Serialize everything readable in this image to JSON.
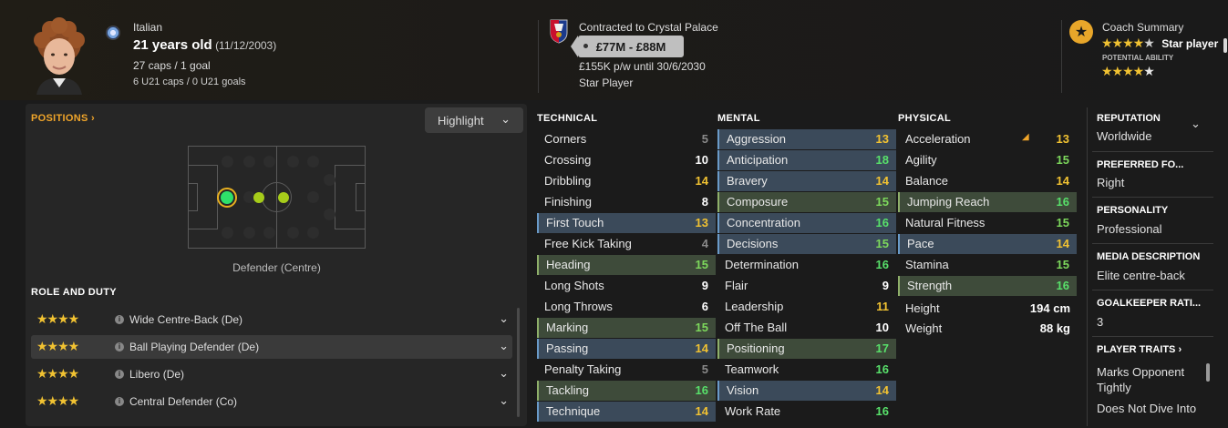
{
  "player": {
    "nationality": "Italian",
    "age_text": "21 years old",
    "dob": "(11/12/2003)",
    "caps": "27 caps / 1 goal",
    "u21": "6 U21 caps / 0 U21 goals"
  },
  "contract": {
    "club_text": "Contracted to Crystal Palace",
    "value": "£77M - £88M",
    "wage": "£155K p/w until 30/6/2030",
    "status": "Star Player"
  },
  "coach": {
    "title": "Coach Summary",
    "current_label": "Star player",
    "current_stars": "★★★★",
    "current_half": "★",
    "potential_title": "POTENTIAL ABILITY",
    "potential_stars": "★★★★",
    "potential_empty": "★"
  },
  "positions": {
    "title": "POSITIONS",
    "chevron": "›",
    "highlight_label": "Highlight",
    "caption": "Defender (Centre)"
  },
  "roles": {
    "title": "ROLE AND DUTY",
    "items": [
      {
        "stars": "★★★★",
        "label": "Wide Centre-Back (De)"
      },
      {
        "stars": "★★★★",
        "label": "Ball Playing Defender (De)"
      },
      {
        "stars": "★★★★",
        "label": "Libero (De)"
      },
      {
        "stars": "★★★★",
        "label": "Central Defender (Co)"
      }
    ]
  },
  "technical": {
    "title": "TECHNICAL",
    "rows": [
      {
        "label": "Corners",
        "value": "5"
      },
      {
        "label": "Crossing",
        "value": "10"
      },
      {
        "label": "Dribbling",
        "value": "14"
      },
      {
        "label": "Finishing",
        "value": "8"
      },
      {
        "label": "First Touch",
        "value": "13"
      },
      {
        "label": "Free Kick Taking",
        "value": "4"
      },
      {
        "label": "Heading",
        "value": "15"
      },
      {
        "label": "Long Shots",
        "value": "9"
      },
      {
        "label": "Long Throws",
        "value": "6"
      },
      {
        "label": "Marking",
        "value": "15"
      },
      {
        "label": "Passing",
        "value": "14"
      },
      {
        "label": "Penalty Taking",
        "value": "5"
      },
      {
        "label": "Tackling",
        "value": "16"
      },
      {
        "label": "Technique",
        "value": "14"
      }
    ]
  },
  "mental": {
    "title": "MENTAL",
    "rows": [
      {
        "label": "Aggression",
        "value": "13"
      },
      {
        "label": "Anticipation",
        "value": "18"
      },
      {
        "label": "Bravery",
        "value": "14"
      },
      {
        "label": "Composure",
        "value": "15"
      },
      {
        "label": "Concentration",
        "value": "16"
      },
      {
        "label": "Decisions",
        "value": "15"
      },
      {
        "label": "Determination",
        "value": "16"
      },
      {
        "label": "Flair",
        "value": "9"
      },
      {
        "label": "Leadership",
        "value": "11"
      },
      {
        "label": "Off The Ball",
        "value": "10"
      },
      {
        "label": "Positioning",
        "value": "17"
      },
      {
        "label": "Teamwork",
        "value": "16"
      },
      {
        "label": "Vision",
        "value": "14"
      },
      {
        "label": "Work Rate",
        "value": "16"
      }
    ]
  },
  "physical": {
    "title": "PHYSICAL",
    "rows": [
      {
        "label": "Acceleration",
        "value": "13"
      },
      {
        "label": "Agility",
        "value": "15"
      },
      {
        "label": "Balance",
        "value": "14"
      },
      {
        "label": "Jumping Reach",
        "value": "16"
      },
      {
        "label": "Natural Fitness",
        "value": "15"
      },
      {
        "label": "Pace",
        "value": "14"
      },
      {
        "label": "Stamina",
        "value": "15"
      },
      {
        "label": "Strength",
        "value": "16"
      }
    ],
    "height_label": "Height",
    "height_value": "194 cm",
    "weight_label": "Weight",
    "weight_value": "88 kg"
  },
  "info": {
    "reputation_title": "REPUTATION",
    "reputation": "Worldwide",
    "foot_title": "PREFERRED FO...",
    "foot": "Right",
    "personality_title": "PERSONALITY",
    "personality": "Professional",
    "media_title": "MEDIA DESCRIPTION",
    "media": "Elite centre-back",
    "gk_title": "GOALKEEPER RATI...",
    "gk": "3",
    "traits_title": "PLAYER TRAITS",
    "traits_chevron": "›",
    "trait1_line1": "Marks Opponent",
    "trait1_line2": "Tightly",
    "trait2": "Does Not Dive Into"
  },
  "colors": {
    "accent_orange": "#f0a52a",
    "star_gold": "#f1c232",
    "good_green": "#58e06a",
    "mid_yellow": "#f1c232"
  }
}
